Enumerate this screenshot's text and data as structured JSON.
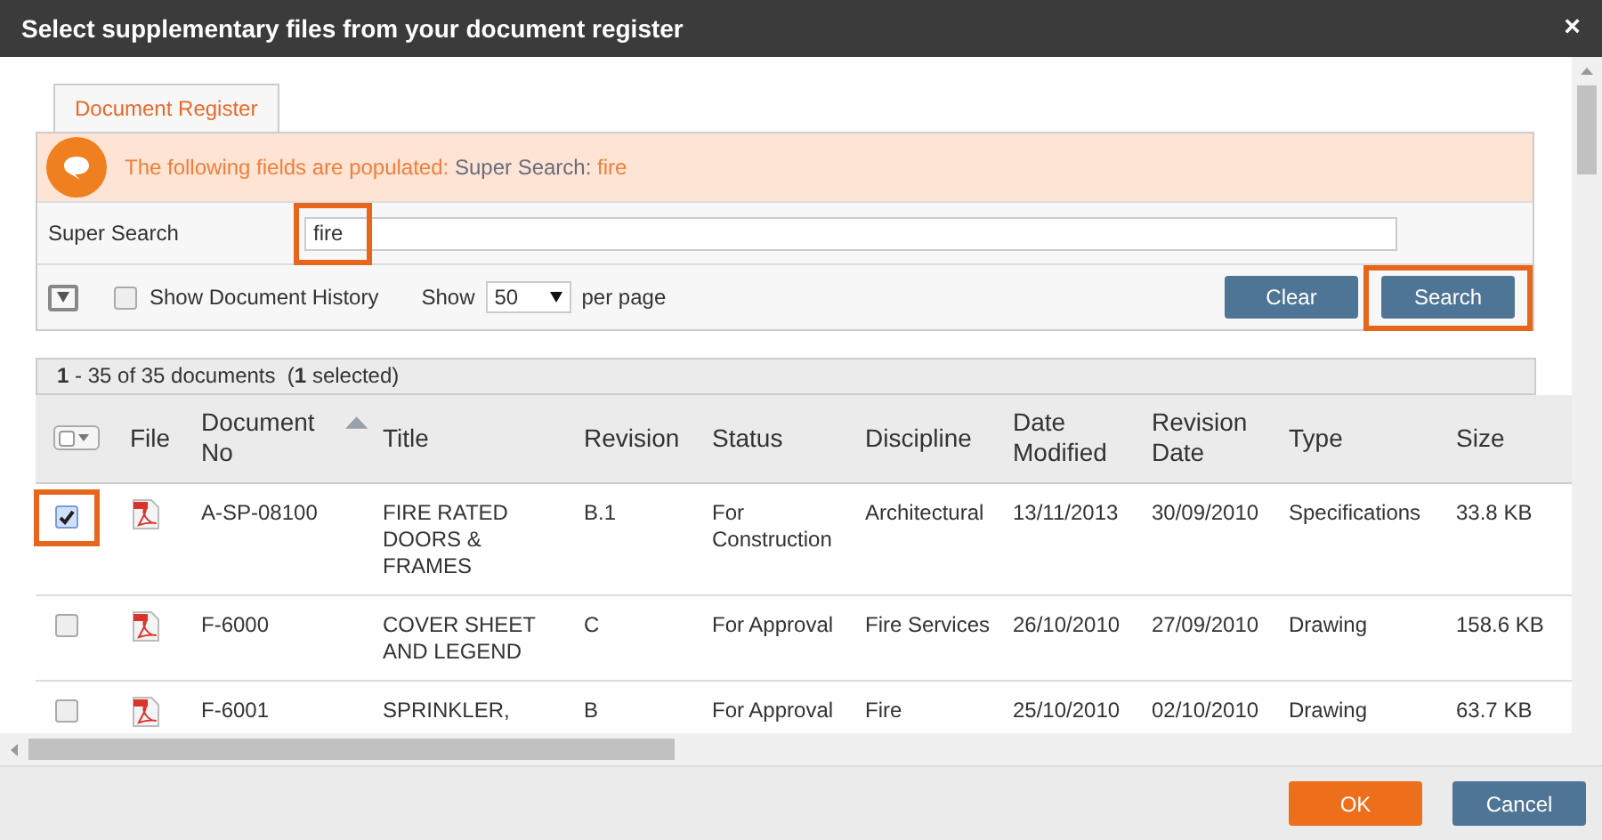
{
  "window": {
    "title": "Select supplementary files from your document register",
    "close": "×"
  },
  "tabs": [
    {
      "label": "Document Register",
      "selected": true
    }
  ],
  "banner": {
    "text": "The following fields are populated:",
    "field": "Super Search:",
    "value": "fire"
  },
  "super_search": {
    "label": "Super Search",
    "value": "fire",
    "highlighted": true
  },
  "toolbar": {
    "show_history": {
      "label": "Show Document History",
      "checked": false
    },
    "show_label": "Show",
    "page_size": "50",
    "per_page": "per page",
    "clear": "Clear",
    "search": {
      "label": "Search",
      "highlighted": true
    }
  },
  "count": "**1** - 35 of 35 documents  (**1** selected)",
  "table": {
    "select_all": {
      "checked": false
    },
    "columns": [
      "File",
      "Document No",
      "Title",
      "Revision",
      "Status",
      "Discipline",
      "Date Modified",
      "Revision Date",
      "Type",
      "Size"
    ],
    "rows": [
      {
        "checked": true,
        "highlighted": true,
        "cells": [
          "",
          "A-SP-08100",
          "FIRE RATED DOORS & FRAMES",
          "B.1",
          "For Construction",
          "Architectural",
          "13/11/2013",
          "30/09/2010",
          "Specifications",
          "33.8 KB"
        ]
      },
      {
        "checked": false,
        "highlighted": false,
        "cells": [
          "",
          "F-6000",
          "COVER SHEET AND LEGEND",
          "C",
          "For Approval",
          "Fire Services",
          "26/10/2010",
          "27/09/2010",
          "Drawing",
          "158.6 KB"
        ]
      },
      {
        "checked": false,
        "highlighted": false,
        "cells": [
          "",
          "F-6001",
          "SPRINKLER,",
          "B",
          "For Approval",
          "Fire",
          "25/10/2010",
          "02/10/2010",
          "Drawing",
          "63.7 KB"
        ]
      }
    ]
  },
  "buttons": [
    {
      "label": "OK",
      "kind": "primary"
    },
    {
      "label": "Cancel",
      "kind": "secondary"
    }
  ]
}
